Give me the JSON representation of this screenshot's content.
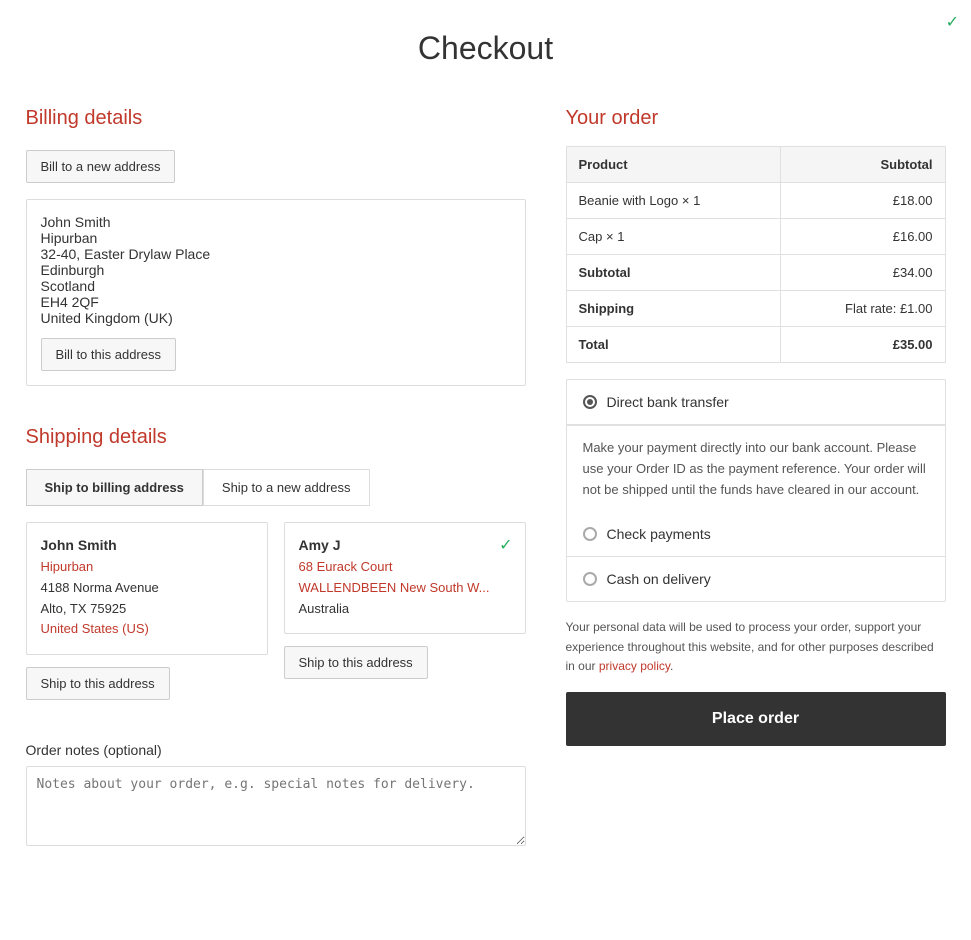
{
  "page": {
    "title": "Checkout"
  },
  "billing": {
    "section_title": "Billing details",
    "new_address_btn": "Bill to a new address",
    "saved_address": {
      "name": "John Smith",
      "line1": "Hipurban",
      "line2": "32-40, Easter Drylaw Place",
      "city": "Edinburgh",
      "region": "Scotland",
      "postcode": "EH4 2QF",
      "country": "United Kingdom (UK)",
      "select_btn": "Bill to this address"
    }
  },
  "shipping": {
    "section_title": "Shipping details",
    "tab_billing": "Ship to billing address",
    "tab_new": "Ship to a new address",
    "address1": {
      "name": "John Smith",
      "line1": "Hipurban",
      "line2": "4188 Norma Avenue",
      "city": "Alto, TX 75925",
      "country": "United States (US)",
      "select_btn": "Ship to this address"
    },
    "address2": {
      "name": "Amy J",
      "line1": "68 Eurack Court",
      "line2": "WALLENDBEEN New South W...",
      "country": "Australia",
      "select_btn": "Ship to this address"
    }
  },
  "order_notes": {
    "label": "Order notes (optional)",
    "placeholder": "Notes about your order, e.g. special notes for delivery."
  },
  "your_order": {
    "title": "Your order",
    "col_product": "Product",
    "col_subtotal": "Subtotal",
    "items": [
      {
        "name": "Beanie with Logo",
        "qty": "× 1",
        "price": "£18.00"
      },
      {
        "name": "Cap",
        "qty": "× 1",
        "price": "£16.00"
      }
    ],
    "subtotal_label": "Subtotal",
    "subtotal_value": "£34.00",
    "shipping_label": "Shipping",
    "shipping_value": "Flat rate: £1.00",
    "total_label": "Total",
    "total_value": "£35.00"
  },
  "payment": {
    "options": [
      {
        "id": "bank_transfer",
        "label": "Direct bank transfer",
        "selected": true
      },
      {
        "id": "check",
        "label": "Check payments",
        "selected": false
      },
      {
        "id": "cod",
        "label": "Cash on delivery",
        "selected": false
      }
    ],
    "bank_desc": "Make your payment directly into our bank account. Please use your Order ID as the payment reference. Your order will not be shipped until the funds have cleared in our account.",
    "privacy_note": "Your personal data will be used to process your order, support your experience throughout this website, and for other purposes described in our ",
    "privacy_link": "privacy policy",
    "privacy_end": ".",
    "place_order_btn": "Place order"
  }
}
